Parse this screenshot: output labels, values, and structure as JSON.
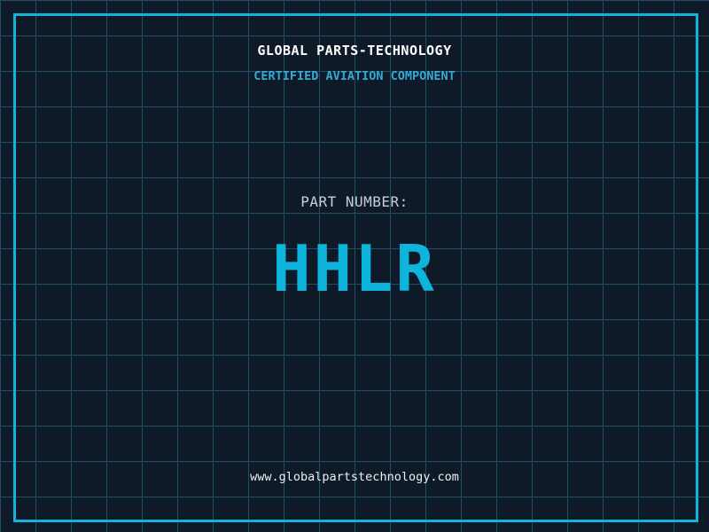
{
  "brand": {
    "title": "GLOBAL PARTS-TECHNOLOGY",
    "subtitle": "CERTIFIED AVIATION COMPONENT"
  },
  "part": {
    "label": "PART NUMBER:",
    "number": "HHLR"
  },
  "footer": {
    "website": "www.globalpartstechnology.com"
  },
  "colors": {
    "background": "#0f1a29",
    "grid_line": "#1e4f66",
    "frame_border": "#12b4dc",
    "title_text": "#ffffff",
    "subtitle_text": "#35aad2",
    "part_label_text": "#c9ced8",
    "part_number_text": "#0db4dc",
    "website_text": "#eef0f2"
  },
  "layout_meta": {
    "grid_cell_px": "40"
  }
}
